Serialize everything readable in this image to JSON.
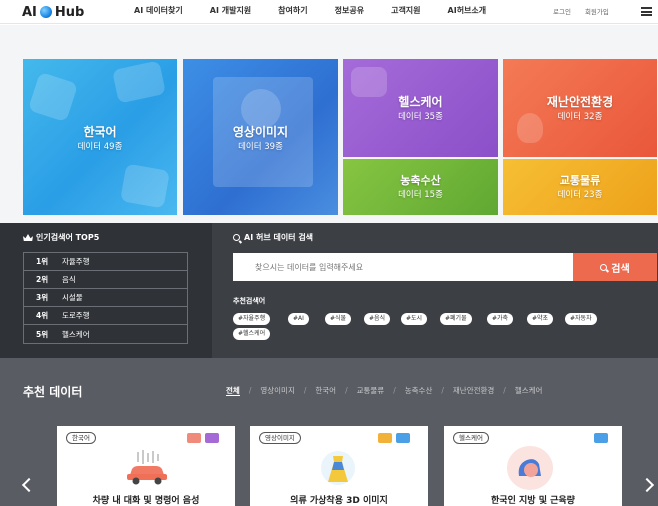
{
  "header": {
    "logo": {
      "left": "AI",
      "right": "Hub"
    },
    "nav": [
      "AI 데이터찾기",
      "AI 개발지원",
      "참여하기",
      "정보공유",
      "고객지원",
      "AI허브소개"
    ],
    "util": {
      "login": "로그인",
      "signup": "회원가입"
    }
  },
  "tiles": [
    {
      "title": "한국어",
      "sub": "데이터 49종",
      "color": "#3fb1eb"
    },
    {
      "title": "영상이미지",
      "sub": "데이터 39종",
      "color": "#3a85e0"
    },
    {
      "title": "헬스케어",
      "sub": "데이터 35종",
      "color": "#9a5fd2"
    },
    {
      "title": "재난안전환경",
      "sub": "데이터 32종",
      "color": "#ee6a48"
    },
    {
      "title": "농축수산",
      "sub": "데이터 15종",
      "color": "#76b93c"
    },
    {
      "title": "교통물류",
      "sub": "데이터 23종",
      "color": "#f2b02a"
    }
  ],
  "popular": {
    "title": "인기검색어 TOP5",
    "items": [
      {
        "rank": "1위",
        "keyword": "자율주행"
      },
      {
        "rank": "2위",
        "keyword": "음식"
      },
      {
        "rank": "3위",
        "keyword": "시설물"
      },
      {
        "rank": "4위",
        "keyword": "도로주행"
      },
      {
        "rank": "5위",
        "keyword": "헬스케어"
      }
    ]
  },
  "search": {
    "title": "AI 허브 데이터 검색",
    "placeholder": "찾으시는 데이터를 입력해주세요",
    "button": "검색",
    "recommended_label": "추천검색어",
    "tags": [
      "#자율주행",
      "#AI",
      "#식물",
      "#음식",
      "#도시",
      "#폐기물",
      "#가축",
      "#약초",
      "#자동차",
      "#헬스케어"
    ]
  },
  "recommended": {
    "title": "추천 데이터",
    "filters": [
      "전체",
      "영상이미지",
      "한국어",
      "교통물류",
      "농축수산",
      "재난안전환경",
      "헬스케어"
    ],
    "cards": [
      {
        "badge": "한국어",
        "title": "차량 내 대화 및 명령어 음성"
      },
      {
        "badge": "영상이미지",
        "title": "의류 가상착용 3D 이미지"
      },
      {
        "badge": "헬스케어",
        "title": "한국인 지방 및 근육량"
      }
    ]
  },
  "colors": {
    "search_button": "#ee6a4f",
    "dark_panel": "#2f3237",
    "section_bg": "#595c62"
  }
}
